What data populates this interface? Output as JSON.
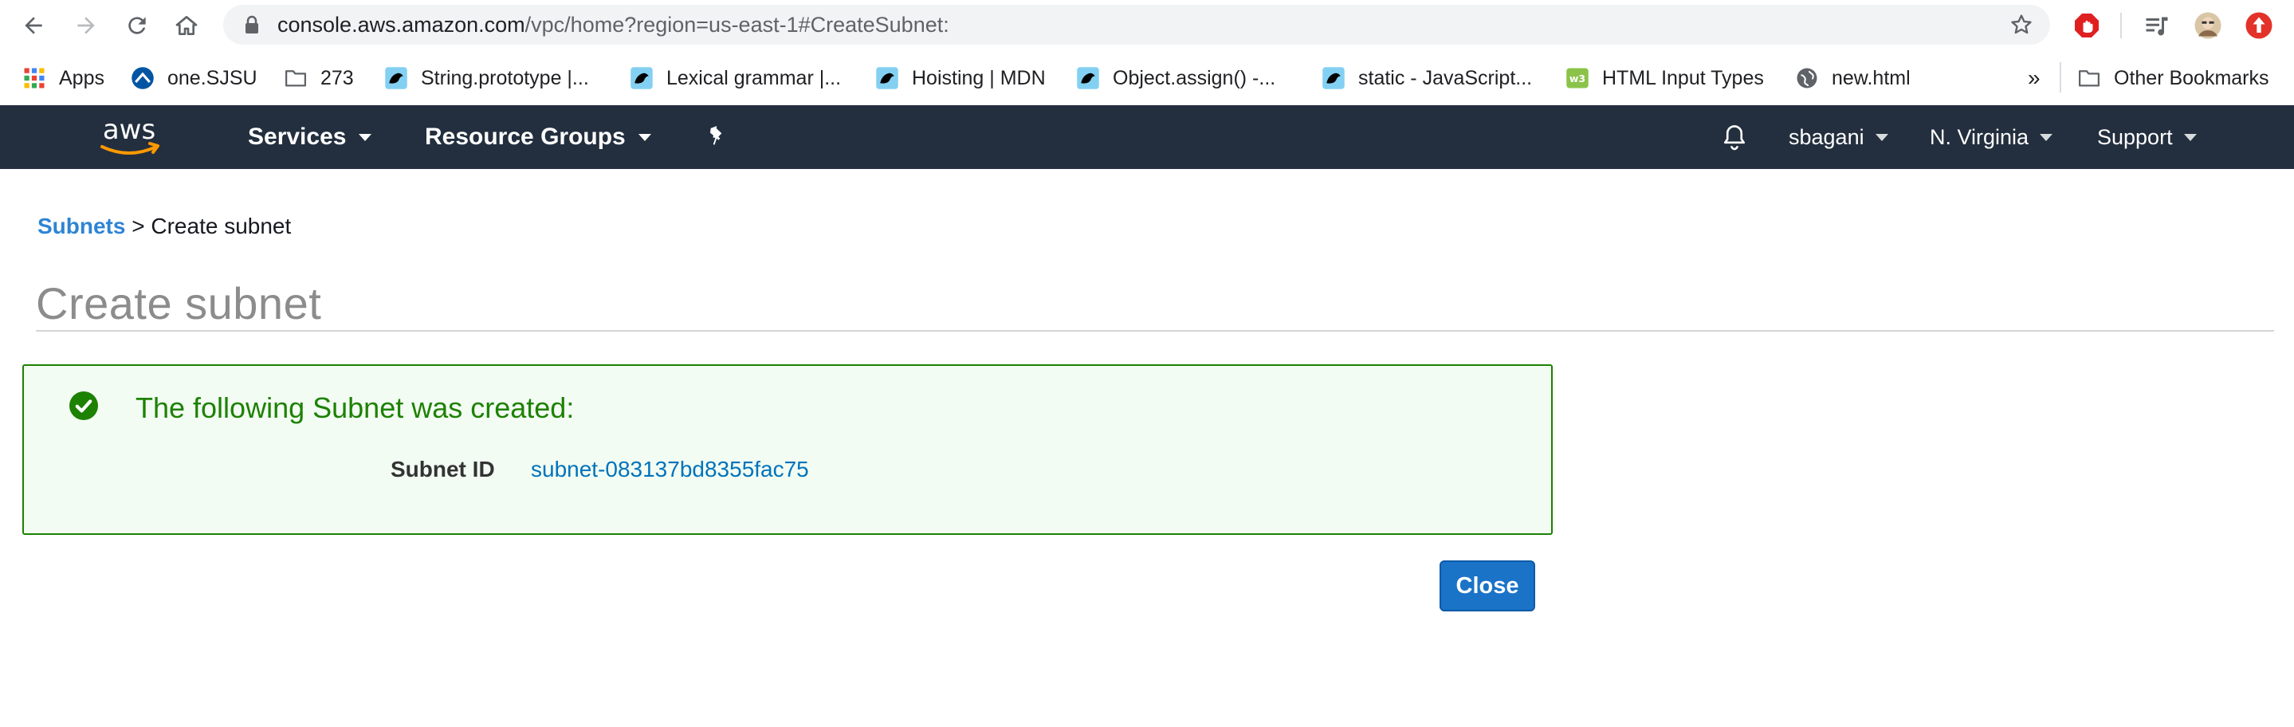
{
  "browser": {
    "url_host": "console.aws.amazon.com",
    "url_path": "/vpc/home?region=us-east-1#CreateSubnet:",
    "nav_icons": [
      "back-icon",
      "forward-icon",
      "reload-icon",
      "home-icon"
    ],
    "extension_icons": [
      "adblock-icon",
      "media-control-icon",
      "profile-avatar",
      "update-icon"
    ]
  },
  "bookmarks": {
    "items": [
      {
        "label": "Apps",
        "icon": "apps-grid-icon"
      },
      {
        "label": "one.SJSU",
        "icon": "sjsu-icon"
      },
      {
        "label": "273",
        "icon": "folder-icon"
      },
      {
        "label": "String.prototype |...",
        "icon": "mdn-icon"
      },
      {
        "label": "Lexical grammar |...",
        "icon": "mdn-icon"
      },
      {
        "label": "Hoisting | MDN",
        "icon": "mdn-icon"
      },
      {
        "label": "Object.assign() -...",
        "icon": "mdn-icon"
      },
      {
        "label": "static - JavaScript...",
        "icon": "mdn-icon"
      },
      {
        "label": "HTML Input Types",
        "icon": "w3-icon"
      },
      {
        "label": "new.html",
        "icon": "globe-icon"
      }
    ],
    "overflow": "»",
    "other": "Other Bookmarks"
  },
  "aws_header": {
    "logo_text": "aws",
    "services": "Services",
    "resource_groups": "Resource Groups",
    "user": "sbagani",
    "region": "N. Virginia",
    "support": "Support"
  },
  "breadcrumb": {
    "link": "Subnets",
    "separator": ">",
    "current": "Create subnet"
  },
  "page_title": "Create subnet",
  "success": {
    "message": "The following Subnet was created:",
    "label": "Subnet ID",
    "value": "subnet-083137bd8355fac75"
  },
  "close_label": "Close",
  "colors": {
    "aws_nav_bg": "#232f3e",
    "aws_orange": "#ff9900",
    "success_green": "#1d8102",
    "link_blue": "#0073bb",
    "button_blue": "#1a73c7"
  }
}
